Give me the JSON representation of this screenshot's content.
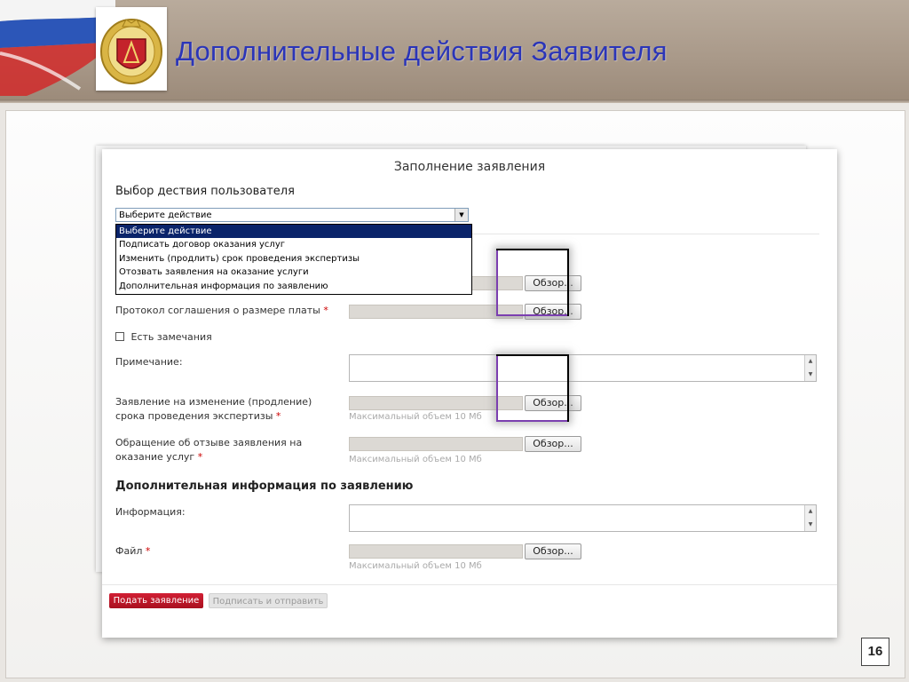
{
  "slide": {
    "title": "Дополнительные действия Заявителя",
    "page_number": "16"
  },
  "form": {
    "title": "Заполнение заявления",
    "action_section_label": "Выбор дествия пользователя",
    "select": {
      "value": "Выберите действие",
      "options": [
        "Выберите действие",
        "Подписать договор оказания услуг",
        "Изменить (продлить) срок проведения экспертизы",
        "Отозвать заявления на оказание услуги",
        "Дополнительная информация по заявлению"
      ],
      "selected_index": 0
    },
    "browse_label": "Обзор...",
    "max_size_hint": "Максимальный объем 10 Мб",
    "required_mark": "*",
    "fields": {
      "protocol": "Протокол соглашения о размере платы",
      "has_remarks": "Есть замечания",
      "note": "Примечание:",
      "change_request": "Заявление на изменение (продление) срока проведения экспертизы",
      "withdraw_request": "Обращение об отзыве заявления на оказание услуг"
    },
    "extra_section_label": "Дополнительная информация по заявлению",
    "extra_fields": {
      "info": "Информация:",
      "file": "Файл"
    },
    "buttons": {
      "submit": "Подать заявление",
      "sign_send": "Подписать и отправить"
    }
  },
  "colors": {
    "title": "#2b35b8",
    "submit_button": "#c0192c",
    "selected_option": "#0a246a",
    "required": "#cc0000",
    "highlight_accent": "#7b3fb0"
  }
}
